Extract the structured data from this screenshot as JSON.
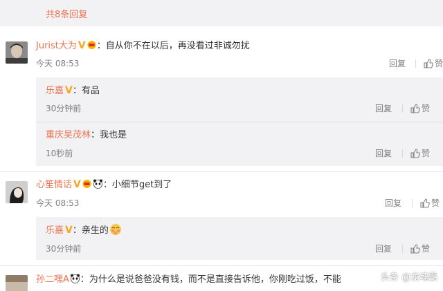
{
  "header": {
    "count_text": "共8条回复"
  },
  "comments": [
    {
      "username": "Jurist大为",
      "badge": "V",
      "text": "自从你不在以后，再没看过非诚勿扰",
      "time": "今天 08:53",
      "reply_label": "回复",
      "like_label": "赞",
      "replies": [
        {
          "username": "乐嘉",
          "badge": "V",
          "text": "有品",
          "time": "30分钟前",
          "reply_label": "回复",
          "like_label": "赞"
        },
        {
          "username": "重庆吴茂林",
          "text": "我也是",
          "time": "10秒前",
          "reply_label": "回复",
          "like_label": "赞"
        }
      ]
    },
    {
      "username": "心笙情话",
      "badge": "V",
      "text": "小细节get到了",
      "time": "今天 08:53",
      "reply_label": "回复",
      "like_label": "赞",
      "replies": [
        {
          "username": "乐嘉",
          "badge": "V",
          "text": "亲生的",
          "time": "30分钟前",
          "reply_label": "回复",
          "like_label": "赞"
        }
      ]
    },
    {
      "username": "孙二嘿A",
      "text": "为什么是说爸爸没有钱，而不是直接告诉他，你刚吃过饭，不能"
    }
  ],
  "watermark": "头条 @龙魂霸",
  "colors": {
    "username": "#eb7350",
    "badge": "#f6a623",
    "meta": "#808080",
    "reply_bg": "#f2f2f5",
    "header_bg": "#f2f2f5"
  }
}
